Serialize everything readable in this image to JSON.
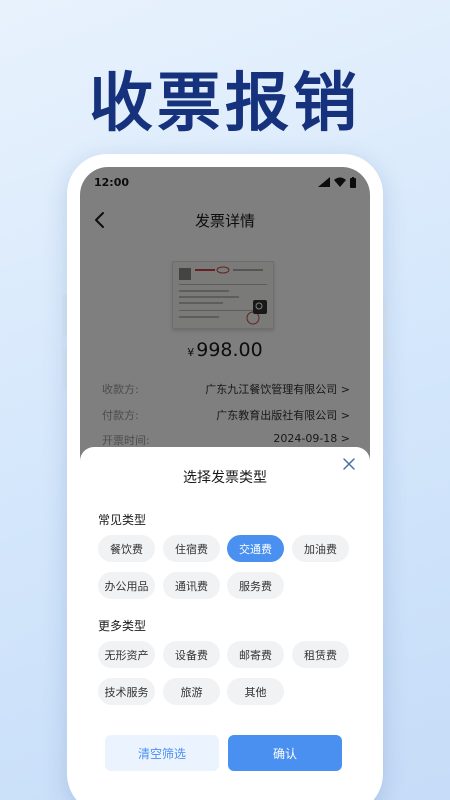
{
  "promo": {
    "title": "收票报销"
  },
  "status_bar": {
    "time": "12:00"
  },
  "nav": {
    "title": "发票详情"
  },
  "invoice": {
    "currency": "¥",
    "amount": "998.00"
  },
  "details": [
    {
      "key": "收款方:",
      "value": "广东九江餐饮管理有限公司 >"
    },
    {
      "key": "付款方:",
      "value": "广东教育出版社有限公司 >"
    },
    {
      "key": "开票时间:",
      "value": "2024-09-18 >"
    }
  ],
  "sheet": {
    "title": "选择发票类型",
    "common_title": "常见类型",
    "common_types": [
      {
        "label": "餐饮费",
        "selected": false
      },
      {
        "label": "住宿费",
        "selected": false
      },
      {
        "label": "交通费",
        "selected": true
      },
      {
        "label": "加油费",
        "selected": false
      },
      {
        "label": "办公用品",
        "selected": false
      },
      {
        "label": "通讯费",
        "selected": false
      },
      {
        "label": "服务费",
        "selected": false
      }
    ],
    "more_title": "更多类型",
    "more_types": [
      {
        "label": "无形资产"
      },
      {
        "label": "设备费"
      },
      {
        "label": "邮寄费"
      },
      {
        "label": "租赁费"
      },
      {
        "label": "技术服务"
      },
      {
        "label": "旅游"
      },
      {
        "label": "其他"
      }
    ],
    "clear_label": "清空筛选",
    "confirm_label": "确认"
  },
  "colors": {
    "accent": "#4a90f0",
    "promo_text": "#16327d"
  }
}
